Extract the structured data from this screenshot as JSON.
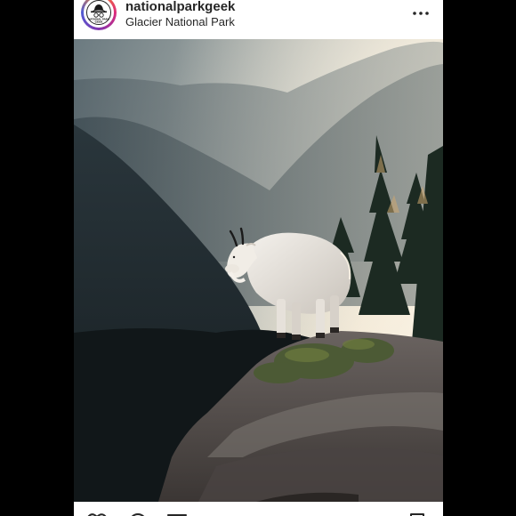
{
  "post": {
    "username": "nationalparkgeek",
    "location": "Glacier National Park"
  },
  "avatar": {
    "logo_text": "NATIONAL PARK",
    "logo_text_2": "GEEK"
  },
  "icons": {
    "more": "more-horizontal-icon",
    "like": "heart-icon",
    "comment": "comment-icon",
    "share": "share-icon",
    "save": "bookmark-icon"
  },
  "photo": {
    "subject": "mountain-goat-on-cliff"
  },
  "colors": {
    "background": "#000000",
    "card": "#ffffff",
    "text": "#262626"
  }
}
